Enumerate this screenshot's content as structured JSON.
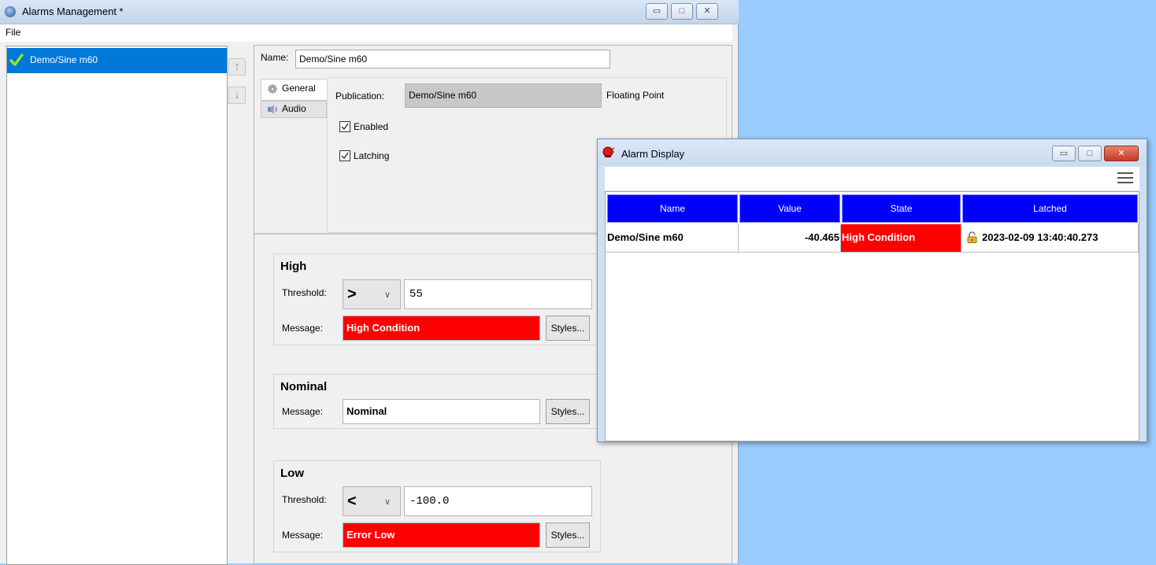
{
  "main_window": {
    "title": "Alarms Management *",
    "menu": {
      "file": "File"
    },
    "controls": {
      "minimize": "▭",
      "maximize": "□",
      "close": "✕"
    }
  },
  "alarm_list": {
    "items": [
      {
        "label": "Demo/Sine m60",
        "status_icon": "check-icon"
      }
    ]
  },
  "editor": {
    "name_label": "Name:",
    "name_value": "Demo/Sine m60",
    "tabs": [
      {
        "label": "General",
        "icon": "gear-icon"
      },
      {
        "label": "Audio",
        "icon": "speaker-icon"
      }
    ],
    "general": {
      "publication_label": "Publication:",
      "publication_value": "Demo/Sine m60",
      "publication_type": "Floating Point",
      "enabled_label": "Enabled",
      "enabled_checked": true,
      "latching_label": "Latching",
      "latching_checked": true
    },
    "high": {
      "title": "High",
      "threshold_label": "Threshold:",
      "operator": ">",
      "threshold_value": "55",
      "message_label": "Message:",
      "message_value": "High Condition",
      "message_bg": "#ff0000",
      "message_fg": "#ffffff",
      "styles_label": "Styles..."
    },
    "nominal": {
      "title": "Nominal",
      "message_label": "Message:",
      "message_value": "Nominal",
      "message_bg": "#ffffff",
      "message_fg": "#000000",
      "styles_label": "Styles..."
    },
    "low": {
      "title": "Low",
      "threshold_label": "Threshold:",
      "operator": "<",
      "threshold_value": "-100.0",
      "message_label": "Message:",
      "message_value": "Error Low",
      "message_bg": "#ff0000",
      "message_fg": "#ffffff",
      "styles_label": "Styles..."
    }
  },
  "alarm_display": {
    "title": "Alarm Display",
    "header_color": "#0000ff",
    "columns": [
      "Name",
      "Value",
      "State",
      "Latched"
    ],
    "rows": [
      {
        "name": "Demo/Sine m60",
        "value": "-40.465",
        "state": "High Condition",
        "state_bg": "#ff0000",
        "latched": "2023-02-09 13:40:40.273",
        "latched_icon": "lock-icon"
      }
    ]
  }
}
